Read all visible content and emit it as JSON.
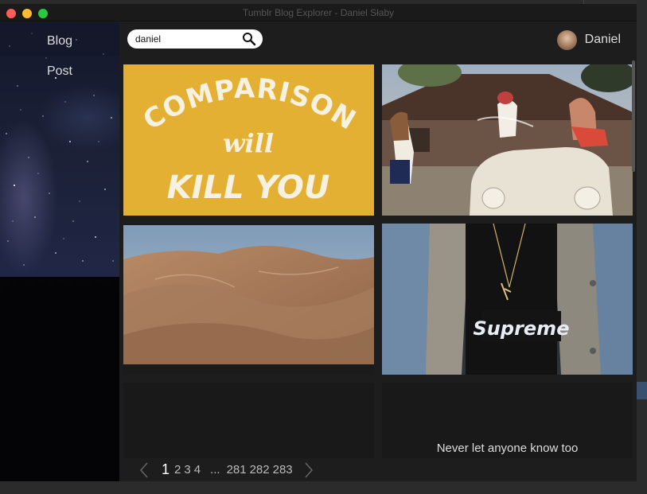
{
  "window": {
    "title": "Tumblr Blog Explorer - Daniel Słaby"
  },
  "sidebar": {
    "items": [
      {
        "label": "Blog"
      },
      {
        "label": "Post"
      }
    ]
  },
  "search": {
    "value": "daniel",
    "icon": "search-icon"
  },
  "user": {
    "name": "Daniel",
    "icon": "avatar"
  },
  "posts": [
    {
      "kind": "image",
      "text": [
        "COMPARISON",
        "will",
        "KILL YOU"
      ],
      "accent": "#e3b033"
    },
    {
      "kind": "image"
    },
    {
      "kind": "image"
    },
    {
      "kind": "image",
      "text": [
        "Supreme"
      ]
    },
    {
      "kind": "empty"
    },
    {
      "kind": "text",
      "text": "Never let anyone know too"
    }
  ],
  "pagination": {
    "current": "1",
    "pages": [
      "2",
      "3",
      "4"
    ],
    "ellipsis": "...",
    "last_pages": [
      "281",
      "282",
      "283"
    ]
  },
  "colors": {
    "background": "#1c1c1c",
    "accent": "#e3b033",
    "text": "#dddddd"
  }
}
